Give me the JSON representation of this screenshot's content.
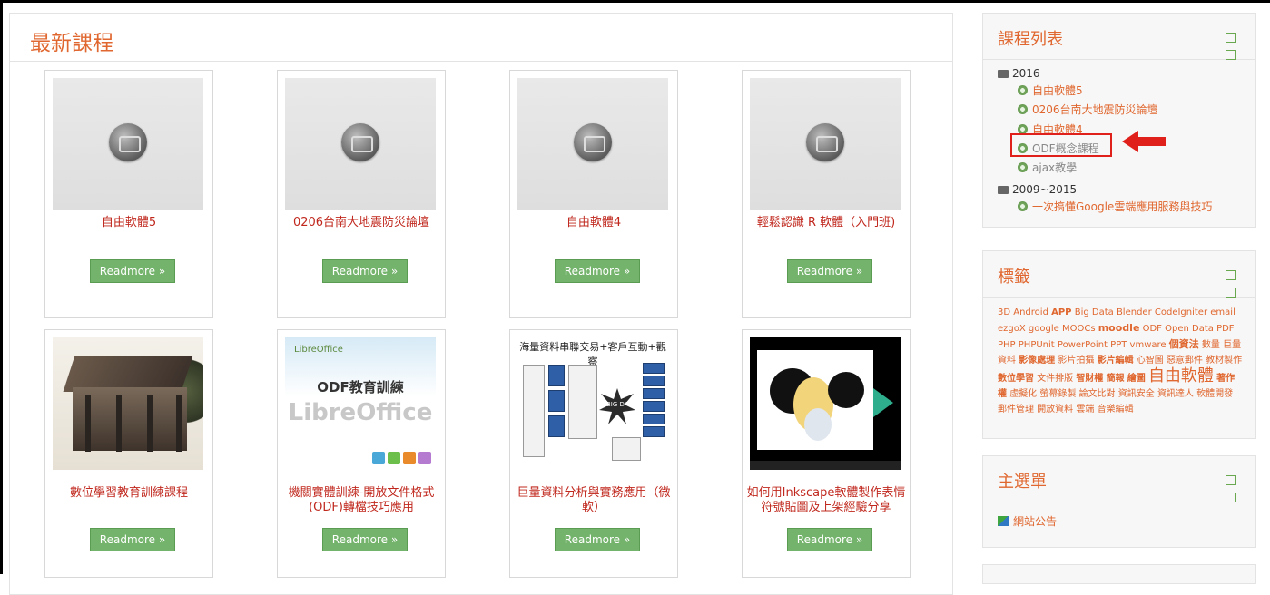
{
  "main": {
    "title": "最新課程",
    "read_more": "Readmore »",
    "courses": [
      {
        "title": "自由軟體5"
      },
      {
        "title": "0206台南大地震防災論壇"
      },
      {
        "title": "自由軟體4"
      },
      {
        "title": "輕鬆認識 R 軟體（入門班)"
      },
      {
        "title": "數位學習教育訓練課程"
      },
      {
        "title": "機關實體訓練-開放文件格式(ODF)轉檔技巧應用"
      },
      {
        "title": "巨量資料分析與實務應用（微軟）"
      },
      {
        "title": "如何用Inkscape軟體製作表情符號貼圖及上架經驗分享"
      }
    ],
    "thumb_texts": {
      "libre_logo": "LibreOffice",
      "libre_heading": "ODF教育訓練",
      "libre_brand": "LibreOffice",
      "bigdata_heading": "海量資料串聯交易+客戶互動+觀察",
      "bigdata_burst": "BIG DATA"
    }
  },
  "sidebar": {
    "course_list": {
      "title": "課程列表",
      "categories": [
        {
          "name": "2016",
          "courses": [
            "自由軟體5",
            "0206台南大地震防災論壇",
            "自由軟體4",
            "ODF概念課程",
            "ajax教學"
          ]
        },
        {
          "name": "2009~2015",
          "courses": [
            "一次搞懂Google雲端應用服務與技巧"
          ]
        }
      ]
    },
    "tags": {
      "title": "標籤",
      "items": [
        "3D",
        "Android",
        "APP",
        "Big Data",
        "Blender",
        "CodeIgniter",
        "email",
        "ezgoX",
        "google",
        "MOOCs",
        "moodle",
        "ODF",
        "Open Data",
        "PDF",
        "PHP",
        "PHPUnit",
        "PowerPoint",
        "PPT",
        "vmware",
        "個資法",
        "數量",
        "巨量資料",
        "影像處理",
        "影片拍攝",
        "影片編輯",
        "心智圖",
        "惡意郵件",
        "教材製作",
        "數位學習",
        "文件排版",
        "智財權",
        "簡報",
        "繪圖",
        "自由軟體",
        "著作權",
        "虛擬化",
        "螢幕錄製",
        "論文比對",
        "資訊安全",
        "資訊達人",
        "軟體開發",
        "郵件管理",
        "開放資料",
        "雲端",
        "音樂編輯"
      ]
    },
    "main_menu": {
      "title": "主選單",
      "items": [
        "網站公告"
      ]
    }
  },
  "colors": {
    "accent": "#e0672f",
    "button": "#73b36b",
    "course_title": "#c0281e",
    "highlight": "#e0201a"
  },
  "icons": {
    "folder": "folder-icon",
    "course": "course-icon",
    "collapse": "collapse-icon",
    "dock": "dock-icon",
    "camera": "camera-icon",
    "announcement": "announcement-icon"
  }
}
